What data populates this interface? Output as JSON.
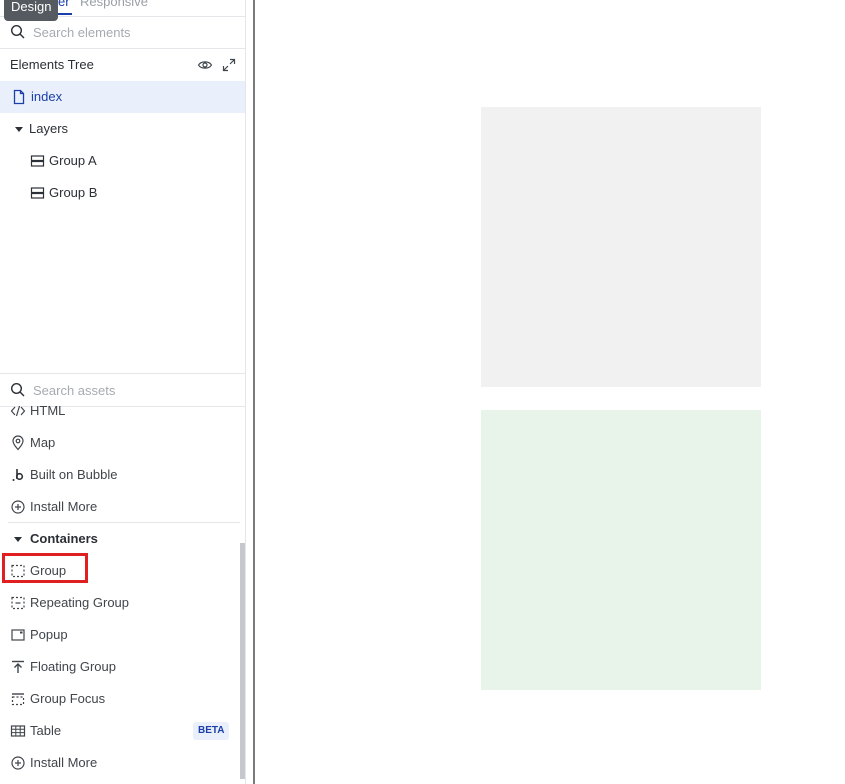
{
  "top_tabs": {
    "design_partial": "er",
    "responsive": "Responsive"
  },
  "tooltip": "Design",
  "elements_search": {
    "placeholder": "Search elements",
    "value": ""
  },
  "elements_tree": {
    "title": "Elements Tree",
    "page": "index",
    "layers_label": "Layers",
    "layers": [
      "Group A",
      "Group B"
    ]
  },
  "assets_search": {
    "placeholder": "Search assets",
    "value": ""
  },
  "assets": {
    "visual_items": [
      "HTML",
      "Map",
      "Built on Bubble",
      "Install More"
    ],
    "containers_label": "Containers",
    "containers": [
      "Group",
      "Repeating Group",
      "Popup",
      "Floating Group",
      "Group Focus",
      "Table",
      "Install More"
    ],
    "table_badge": "BETA"
  },
  "canvas": {
    "group_a_color": "#f1f1f1",
    "group_b_color": "#e8f3ea"
  },
  "colors": {
    "accent": "#1a3fa8",
    "highlight": "#e02020"
  }
}
